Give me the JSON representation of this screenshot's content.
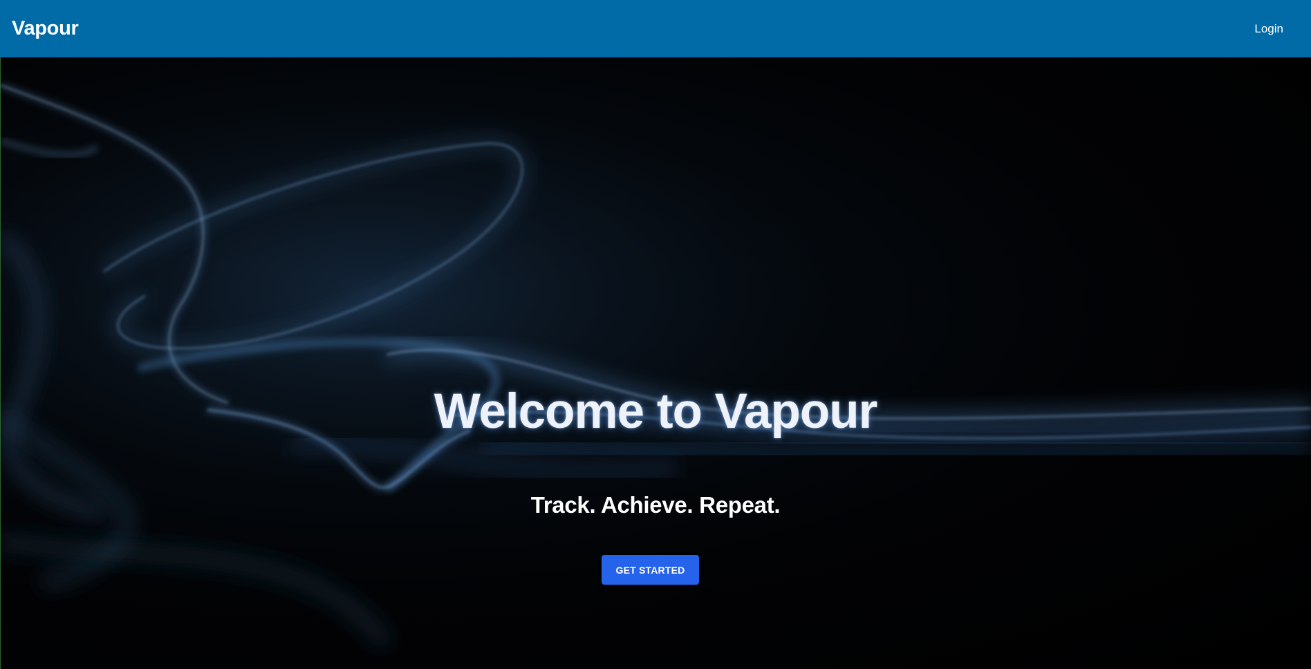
{
  "navbar": {
    "brand": "Vapour",
    "login_label": "Login",
    "background_color": "#006ba6"
  },
  "hero": {
    "title": "Welcome to Vapour",
    "tagline": "Track. Achieve. Repeat.",
    "cta_label": "GET STARTED",
    "cta_color": "#2563eb",
    "background_image": "smoke-image"
  }
}
